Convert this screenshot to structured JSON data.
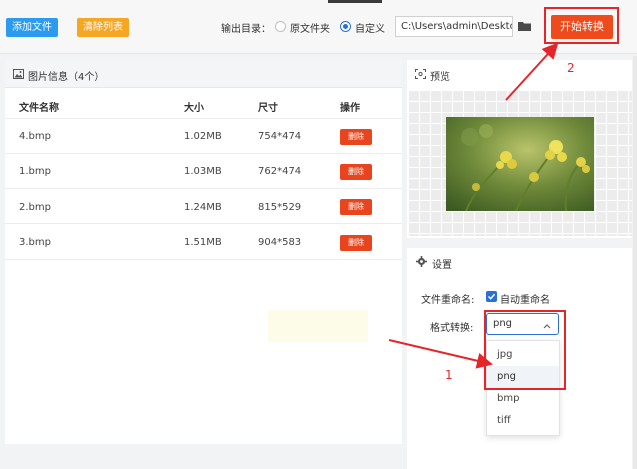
{
  "toolbar": {
    "add_label": "添加文件",
    "clear_label": "清除列表",
    "output_label": "输出目录：",
    "radio_original": "原文件夹",
    "radio_custom": "自定义",
    "radio_selected": "自定义",
    "output_path": "C:\\Users\\admin\\Deskto",
    "start_label": "开始转换"
  },
  "image_panel": {
    "title": "图片信息（4个）",
    "columns": [
      "文件名称",
      "大小",
      "尺寸",
      "操作"
    ],
    "rows": [
      {
        "name": "4.bmp",
        "size": "1.02MB",
        "dims": "754*474",
        "action": "删除"
      },
      {
        "name": "1.bmp",
        "size": "1.03MB",
        "dims": "762*474",
        "action": "删除"
      },
      {
        "name": "2.bmp",
        "size": "1.24MB",
        "dims": "815*529",
        "action": "删除"
      },
      {
        "name": "3.bmp",
        "size": "1.51MB",
        "dims": "904*583",
        "action": "删除"
      }
    ]
  },
  "preview": {
    "title": "预览"
  },
  "settings": {
    "title": "设置",
    "rename_label": "文件重命名:",
    "rename_checkbox_label": "自动重命名",
    "rename_checked": true,
    "format_label": "格式转换:",
    "format_value": "png",
    "format_options": [
      "jpg",
      "png",
      "bmp",
      "tiff"
    ],
    "highlighted_option": "png"
  },
  "annotations": {
    "step1": "1",
    "step2": "2"
  },
  "colors": {
    "accent_blue": "#2b9bf0",
    "accent_orange": "#f5a623",
    "start_red": "#ef4a1c",
    "delete_red": "#e8451e",
    "annotation_red": "#e4262a"
  }
}
